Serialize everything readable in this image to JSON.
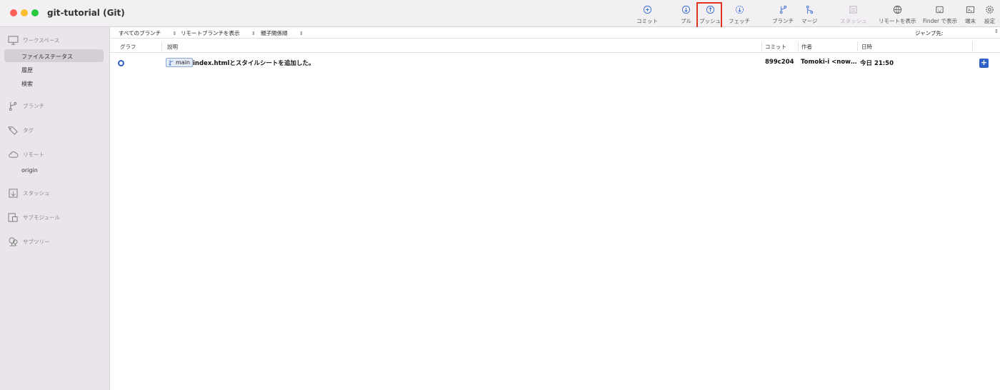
{
  "window": {
    "title": "git-tutorial (Git)"
  },
  "toolbar": {
    "commit": "コミット",
    "pull": "プル",
    "push": "プッシュ",
    "fetch": "フェッチ",
    "branch": "ブランチ",
    "merge": "マージ",
    "stash": "スタッシュ",
    "show_remote": "リモートを表示",
    "show_in_finder": "Finder で表示",
    "terminal": "端末",
    "settings": "設定"
  },
  "sidebar": {
    "workspace": "ワークスペース",
    "workspace_items": [
      "ファイルステータス",
      "履歴",
      "検索"
    ],
    "branches": "ブランチ",
    "tags": "タグ",
    "remotes": "リモート",
    "remote_items": [
      "origin"
    ],
    "stashes": "スタッシュ",
    "submodules": "サブモジュール",
    "subtrees": "サブツリー"
  },
  "filterbar": {
    "branches_filter": "すべてのブランチ",
    "remote_filter": "リモートブランチを表示",
    "order_filter": "親子関係順",
    "jump_to": "ジャンプ先:"
  },
  "columns": {
    "graph": "グラフ",
    "description": "説明",
    "commit": "コミット",
    "author": "作者",
    "date": "日時"
  },
  "commits": [
    {
      "branch": "main",
      "message": "index.htmlとスタイルシートを追加した。",
      "hash": "899c204",
      "author": "Tomoki-i <now…",
      "date": "今日 21:50"
    }
  ],
  "icons": {
    "commit": "plus-circle-icon",
    "pull": "arrow-down-circle-icon",
    "push": "arrow-up-circle-icon",
    "fetch": "fetch-circle-icon",
    "branch": "branch-icon",
    "merge": "merge-icon",
    "stash": "stash-icon",
    "show_remote": "globe-icon",
    "finder": "finder-icon",
    "terminal": "terminal-icon",
    "settings": "gear-icon"
  },
  "colors": {
    "accent": "#2f62c8",
    "highlight": "#e0341f",
    "sidebar_bg": "#e9e5ea"
  }
}
